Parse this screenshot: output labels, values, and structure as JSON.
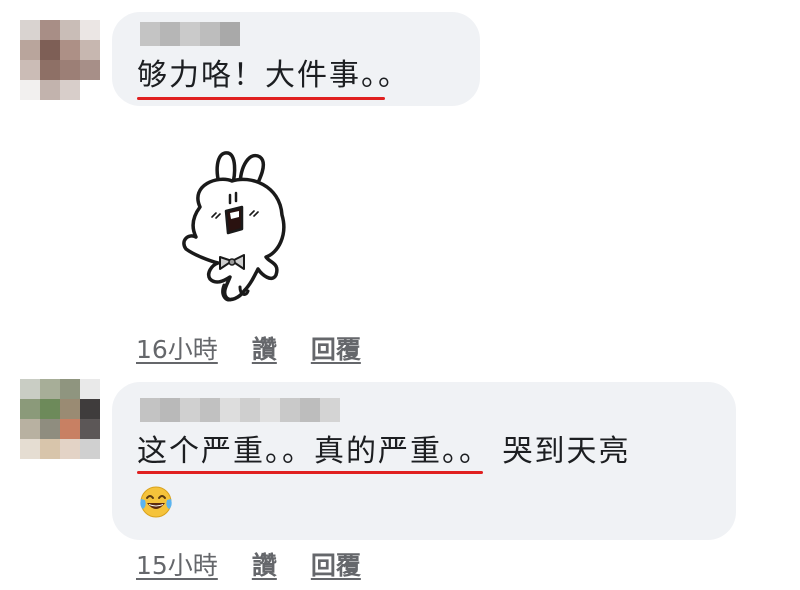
{
  "comments": [
    {
      "text": "够力咯！大件事。。",
      "timestamp": "16小時",
      "like_label": "讚",
      "reply_label": "回覆",
      "has_sticker": true
    },
    {
      "text": "这个严重。。真的严重。。 哭到天亮",
      "emoji": "joy-tears-emoji",
      "timestamp": "15小時",
      "like_label": "讚",
      "reply_label": "回覆"
    }
  ],
  "colors": {
    "bubble": "#f0f2f5",
    "underline": "#e02020",
    "meta_text": "#65676b"
  }
}
